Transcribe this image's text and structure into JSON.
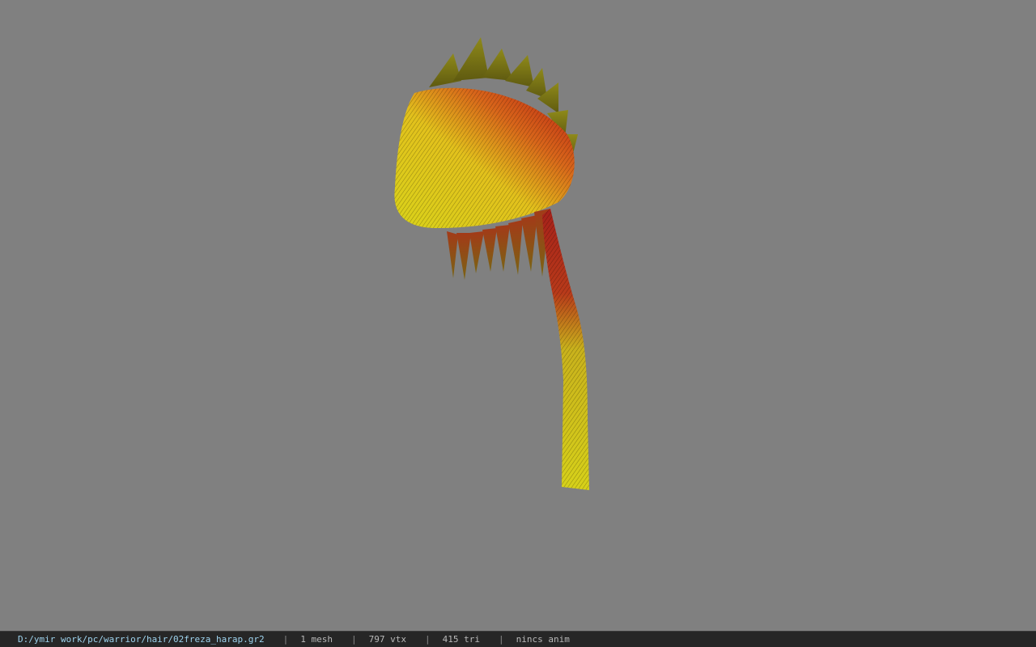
{
  "viewer": {
    "background_color": "#808080",
    "model_icon": "hair-bandana-mesh"
  },
  "status_bar": {
    "file_path": "D:/ymir work/pc/warrior/hair/02freza_harap.gr2",
    "separator": "|",
    "mesh_count": "1 mesh",
    "vertex_count": "797 vtx",
    "triangle_count": "415 tri",
    "animation": "nincs anim",
    "path_color": "#9ed3ee",
    "text_color": "#b9b9b9",
    "bar_color": "#262626"
  }
}
